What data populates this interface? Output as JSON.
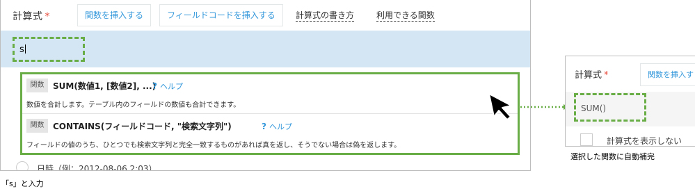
{
  "main": {
    "field_label": "計算式",
    "required_mark": "*",
    "toolbar": {
      "insert_function_label": "関数を挿入する",
      "insert_field_code_label": "フィールドコードを挿入する",
      "how_to_write_label": "計算式の書き方",
      "available_functions_label": "利用できる関数"
    },
    "formula_input_value": "s",
    "suggestions": [
      {
        "badge": "関数",
        "name": "SUM(数値1, [数値2], ...)",
        "help": "ヘルプ",
        "description": "数値を合計します。テーブル内のフィールドの数値も合計できます。"
      },
      {
        "badge": "関数",
        "name": "CONTAINS(フィールドコード, \"検索文字列\")",
        "help": "ヘルプ",
        "description": "フィールドの値のうち、ひとつでも検索文字列と完全一致するものがあれば真を返し、そうでない場合は偽を返します。"
      }
    ],
    "help_icon_glyph": "?",
    "bottom_option_label": "日時（例：2012-08-06 2:03）",
    "caption": "「s」と入力"
  },
  "result": {
    "field_label": "計算式",
    "required_mark": "*",
    "insert_function_label": "関数を挿入す",
    "formula_value": "SUM()",
    "show_formula_label": "計算式を表示しない",
    "caption": "選択した関数に自動補完"
  },
  "colors": {
    "accent_blue": "#3498db",
    "highlight_green": "#68ad45",
    "input_row_bg": "#d4e6f4",
    "required_red": "#e74c3c"
  },
  "icons": {
    "cursor": "mouse-pointer-icon",
    "connector": "dotted-arrow-icon",
    "help": "help-question-icon"
  }
}
